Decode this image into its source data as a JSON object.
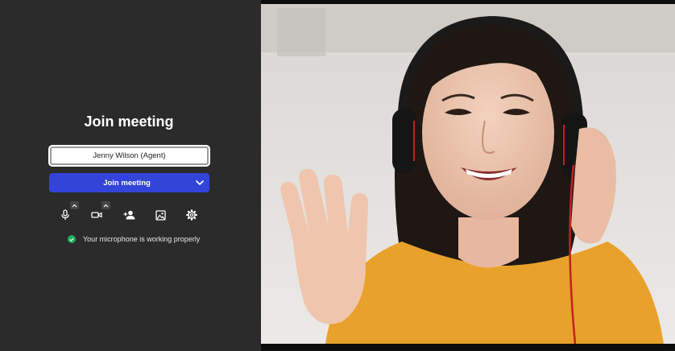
{
  "join_panel": {
    "title": "Join meeting",
    "name_field_value": "Jenny Wilson (Agent)",
    "join_button_label": "Join meeting"
  },
  "toolbar": {
    "items": [
      {
        "icon": "microphone-icon",
        "has_options": true
      },
      {
        "icon": "camera-icon",
        "has_options": true
      },
      {
        "icon": "add-user-icon",
        "has_options": false
      },
      {
        "icon": "background-image-icon",
        "has_options": false
      },
      {
        "icon": "settings-gear-icon",
        "has_options": false
      }
    ]
  },
  "status": {
    "text": "Your microphone is working properly",
    "color": "#1fae59"
  },
  "colors": {
    "background": "#2b2b2b",
    "primary_button": "#3344d9"
  }
}
